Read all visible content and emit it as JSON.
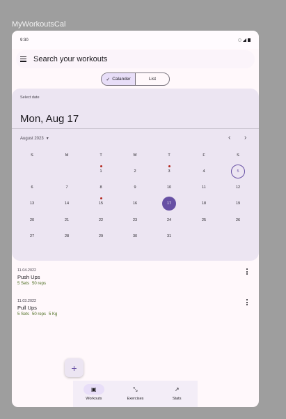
{
  "window": {
    "title": "MyWorkoutsCal"
  },
  "status_bar": {
    "time": "9:30"
  },
  "search": {
    "placeholder": "Search your workouts",
    "menu_icon": "menu-icon"
  },
  "view_toggle": {
    "options": [
      {
        "label": "Calander",
        "selected": true
      },
      {
        "label": "List",
        "selected": false
      }
    ]
  },
  "date_picker": {
    "label": "Select date",
    "selected_date": "Mon, Aug 17",
    "month_label": "August 2023",
    "weekdays": [
      "S",
      "M",
      "T",
      "W",
      "T",
      "F",
      "S"
    ],
    "weeks": [
      [
        "",
        "",
        "1",
        "2",
        "3",
        "4",
        "5"
      ],
      [
        "6",
        "7",
        "8",
        "9",
        "10",
        "11",
        "12"
      ],
      [
        "13",
        "14",
        "15",
        "16",
        "17",
        "18",
        "19"
      ],
      [
        "20",
        "21",
        "22",
        "23",
        "24",
        "25",
        "26"
      ],
      [
        "27",
        "28",
        "29",
        "30",
        "31",
        "",
        ""
      ]
    ],
    "today": "5",
    "selected": "17",
    "workout_days": [
      "1",
      "3",
      "15"
    ],
    "accent_color": "#6750a4",
    "dot_color": "#b3261e"
  },
  "workouts": [
    {
      "date": "11.04.2022",
      "name": "Push Ups",
      "tags": [
        "5 Sets",
        "50 reps"
      ]
    },
    {
      "date": "11.03.2022",
      "name": "Pull Ups",
      "tags": [
        "5 Sets",
        "50 reps",
        "5 Kg"
      ]
    }
  ],
  "fab": {
    "label": "+"
  },
  "bottom_nav": {
    "items": [
      {
        "label": "Workouts",
        "icon": "calendar-icon",
        "active": true
      },
      {
        "label": "Exercises",
        "icon": "dumbbell-icon",
        "active": false
      },
      {
        "label": "Stats",
        "icon": "trending-up-icon",
        "active": false
      }
    ]
  }
}
